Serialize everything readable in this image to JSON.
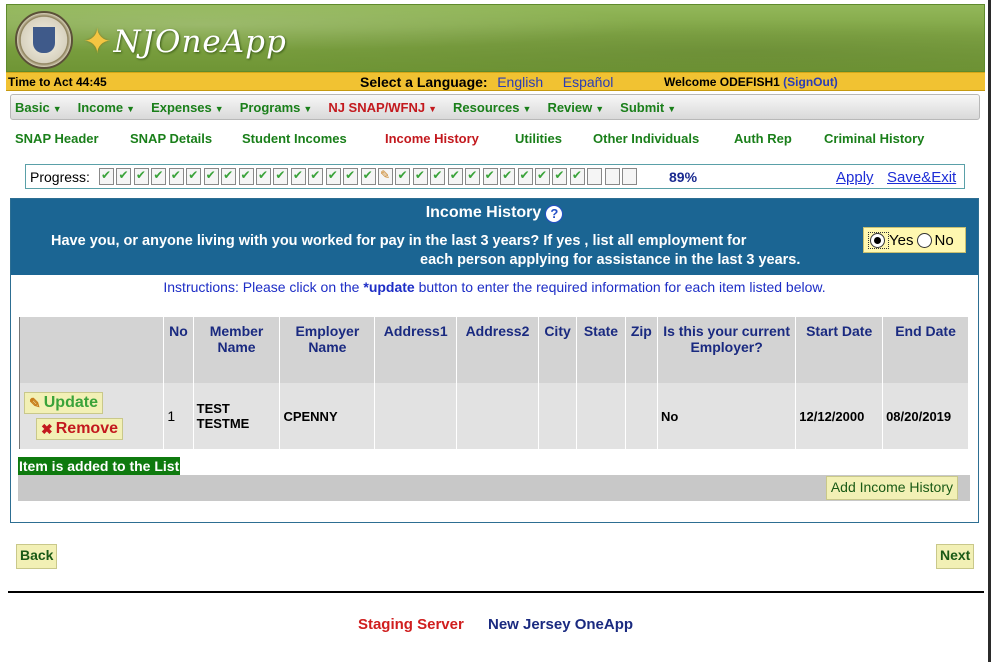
{
  "header": {
    "app_name": "NJOneApp"
  },
  "topbar": {
    "time_to_act": "Time to Act 44:45",
    "select_language_label": "Select a Language:",
    "language_english": "English",
    "language_spanish": "Español",
    "welcome_text": "Welcome ODEFISH1",
    "signout_label": "(SignOut)"
  },
  "menu": {
    "items": [
      {
        "label": "Basic",
        "active": false
      },
      {
        "label": "Income",
        "active": false
      },
      {
        "label": "Expenses",
        "active": false
      },
      {
        "label": "Programs",
        "active": false
      },
      {
        "label": "NJ SNAP/WFNJ",
        "active": true
      },
      {
        "label": "Resources",
        "active": false
      },
      {
        "label": "Review",
        "active": false
      },
      {
        "label": "Submit",
        "active": false
      }
    ]
  },
  "subnav": {
    "items": [
      {
        "label": "SNAP Header",
        "active": false
      },
      {
        "label": "SNAP Details",
        "active": false
      },
      {
        "label": "Student Incomes",
        "active": false
      },
      {
        "label": "Income History",
        "active": true
      },
      {
        "label": "Utilities",
        "active": false
      },
      {
        "label": "Other Individuals",
        "active": false
      },
      {
        "label": "Auth Rep",
        "active": false
      },
      {
        "label": "Criminal History",
        "active": false
      }
    ]
  },
  "progress": {
    "label": "Progress:",
    "steps_total": 31,
    "steps_completed": 16,
    "current_step": 17,
    "percent_text": "89%",
    "apply_label": "Apply",
    "save_exit_label": "Save&Exit"
  },
  "panel": {
    "title": "Income History",
    "question_line1": "Have you, or anyone living with you worked for pay in the last 3 years? If yes , list all employment for",
    "question_line2": "each person applying for assistance in the last 3 years.",
    "yes_label": "Yes",
    "no_label": "No",
    "selected": "Yes",
    "instructions_prefix": "Instructions: Please click on the ",
    "instructions_bold": "*update",
    "instructions_suffix": " button to enter the required information for each item listed below."
  },
  "table": {
    "headers": [
      "",
      "No",
      "Member Name",
      "Employer Name",
      "Address1",
      "Address2",
      "City",
      "State",
      "Zip",
      "Is this your current Employer?",
      "Start Date",
      "End Date"
    ],
    "rows": [
      {
        "update_label": "Update",
        "remove_label": "Remove",
        "no": "1",
        "member_name": "TEST TESTME",
        "employer_name": "CPENNY",
        "address1": "",
        "address2": "",
        "city": "",
        "state": "",
        "zip": "",
        "current_employer": "No",
        "start_date": "12/12/2000",
        "end_date": "08/20/2019"
      }
    ]
  },
  "status": {
    "added_message": "Item is added to the List"
  },
  "buttons": {
    "add_income_history": "Add Income History",
    "back": "Back",
    "next": "Next"
  },
  "footer": {
    "staging": "Staging Server",
    "site_name": "New Jersey OneApp"
  },
  "colors": {
    "banner_green": "#7ea343",
    "top_yellow": "#f1c232",
    "panel_blue": "#1b6593",
    "nav_green": "#1a7f1a",
    "active_red": "#c3191e",
    "link_blue": "#1d2dd6"
  }
}
